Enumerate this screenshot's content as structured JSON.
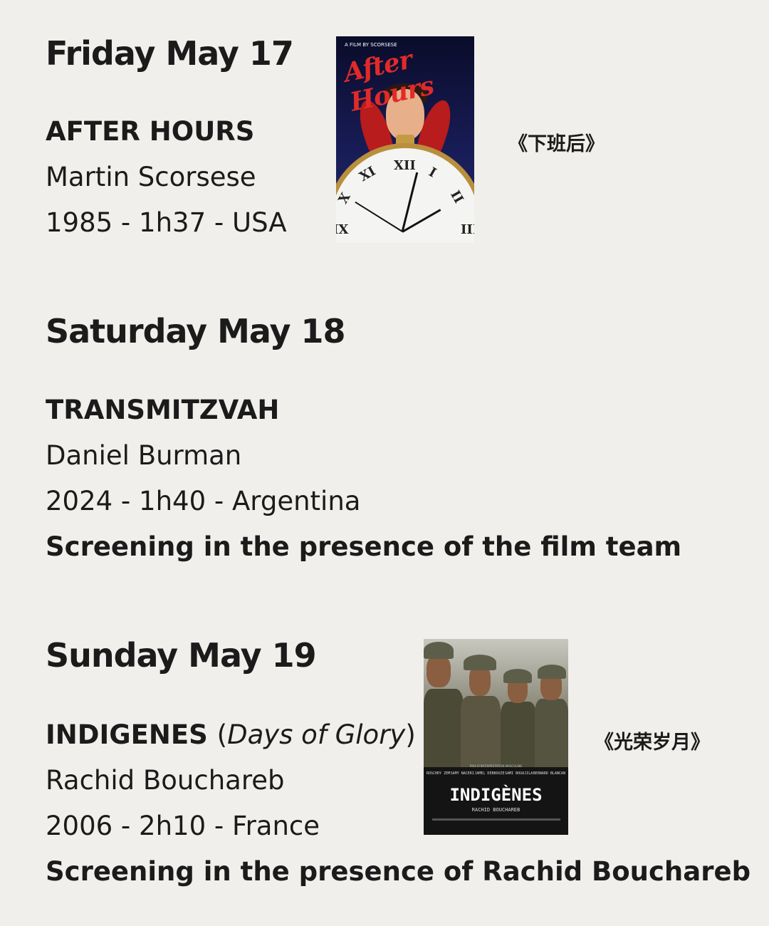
{
  "days": [
    {
      "date": "Friday May 17",
      "title": "AFTER HOURS",
      "director": "Martin Scorsese",
      "info": "1985 - 1h37 - USA",
      "chinese_title": "《下班后》",
      "poster": {
        "credit": "A FILM BY SCORSESE",
        "title": "After Hours"
      }
    },
    {
      "date": "Saturday May 18",
      "title": "TRANSMITZVAH",
      "director": "Daniel Burman",
      "info": "2024 - 1h40 - Argentina",
      "note": "Screening in the presence of the film team"
    },
    {
      "date": "Sunday May 19",
      "title": "INDIGENES",
      "alt_title": "Days of Glory",
      "director": "Rachid Bouchareb",
      "info": "2006 - 2h10 - France",
      "note": "Screening in the presence of Rachid Bouchareb",
      "chinese_title": "《光荣岁月》",
      "poster": {
        "award": "PRIX D'INTERPRETATION MASCULINE",
        "cast": [
          "ROSCHDY ZEM",
          "SAMY NACERI",
          "JAMEL DEBBOUZE",
          "SAMI BOUAJILA",
          "BERNARD BLANCAN"
        ],
        "title": "INDIGÈNES",
        "director": "RACHID BOUCHAREB"
      }
    }
  ]
}
